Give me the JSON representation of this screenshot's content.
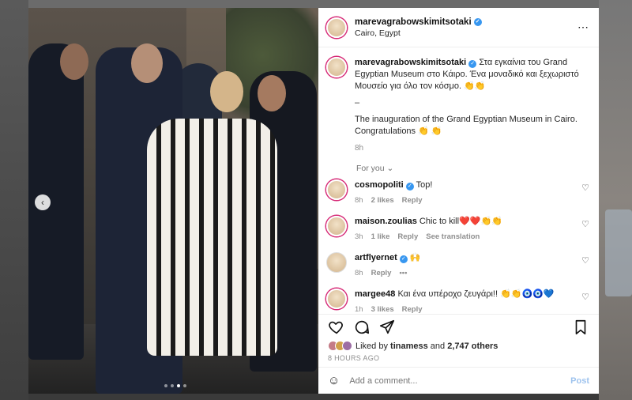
{
  "post": {
    "username": "marevagrabowskimitsotaki",
    "location": "Cairo, Egypt",
    "more_icon": "⋯"
  },
  "caption": {
    "username": "marevagrabowskimitsotaki",
    "text_greek": "Στα εγκαίνια του Grand Egyptian Museum στο Κάιρο. Ένα μοναδικό και ξεχωριστό Μουσείο για όλο τον κόσμο. 👏👏",
    "dash": "–",
    "text_english": "The inauguration of the Grand Egyptian Museum in Cairo. Congratulations 👏 👏",
    "time": "8h"
  },
  "for_you_label": "For you",
  "comments": [
    {
      "username": "cosmopoliti",
      "verified": true,
      "text": "Top!",
      "time": "8h",
      "likes": "2 likes",
      "reply": "Reply",
      "extra": ""
    },
    {
      "username": "maison.zoulias",
      "verified": false,
      "text": "Chic to kill❤️❤️👏👏",
      "time": "3h",
      "likes": "1 like",
      "reply": "Reply",
      "extra": "See translation"
    },
    {
      "username": "artflyernet",
      "verified": true,
      "text": "🙌",
      "time": "8h",
      "likes": "",
      "reply": "Reply",
      "extra": "•••"
    },
    {
      "username": "margee48",
      "verified": false,
      "text": "Και ένα υπέροχο ζευγάρι!! 👏👏🧿🧿💙",
      "time": "1h",
      "likes": "3 likes",
      "reply": "Reply",
      "extra": ""
    }
  ],
  "likes": {
    "prefix": "Liked by ",
    "user": "tinamess",
    "middle": " and ",
    "count": "2,747 others"
  },
  "posted_time": "8 HOURS AGO",
  "comment_input": {
    "placeholder": "Add a comment..."
  },
  "post_button": "Post",
  "carousel": {
    "prev_icon": "‹",
    "slide_count": 4,
    "active_slide": 3
  },
  "colors": {
    "accent": "#3897f0",
    "post_disabled": "#9ec3ee",
    "ring": "#d62976"
  }
}
